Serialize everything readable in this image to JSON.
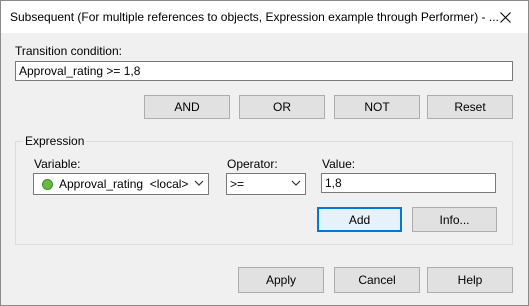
{
  "window": {
    "title": "Subsequent (For multiple references to objects, Expression example through Performer) - ...",
    "close_icon": "close-icon"
  },
  "transition": {
    "label": "Transition condition:",
    "value": "Approval_rating >= 1,8"
  },
  "operators": {
    "and_label": "AND",
    "or_label": "OR",
    "not_label": "NOT",
    "reset_label": "Reset"
  },
  "expression": {
    "group_label": "Expression",
    "variable_label": "Variable:",
    "variable_value": "Approval_rating  <local>",
    "variable_icon": "variable-icon",
    "operator_label": "Operator:",
    "operator_value": ">=",
    "value_label": "Value:",
    "value_value": "1,8",
    "add_label": "Add",
    "info_label": "Info..."
  },
  "footer": {
    "apply_label": "Apply",
    "cancel_label": "Cancel",
    "help_label": "Help"
  },
  "colors": {
    "default_button_border": "#0078d7",
    "variable_icon": "#66bb44"
  }
}
